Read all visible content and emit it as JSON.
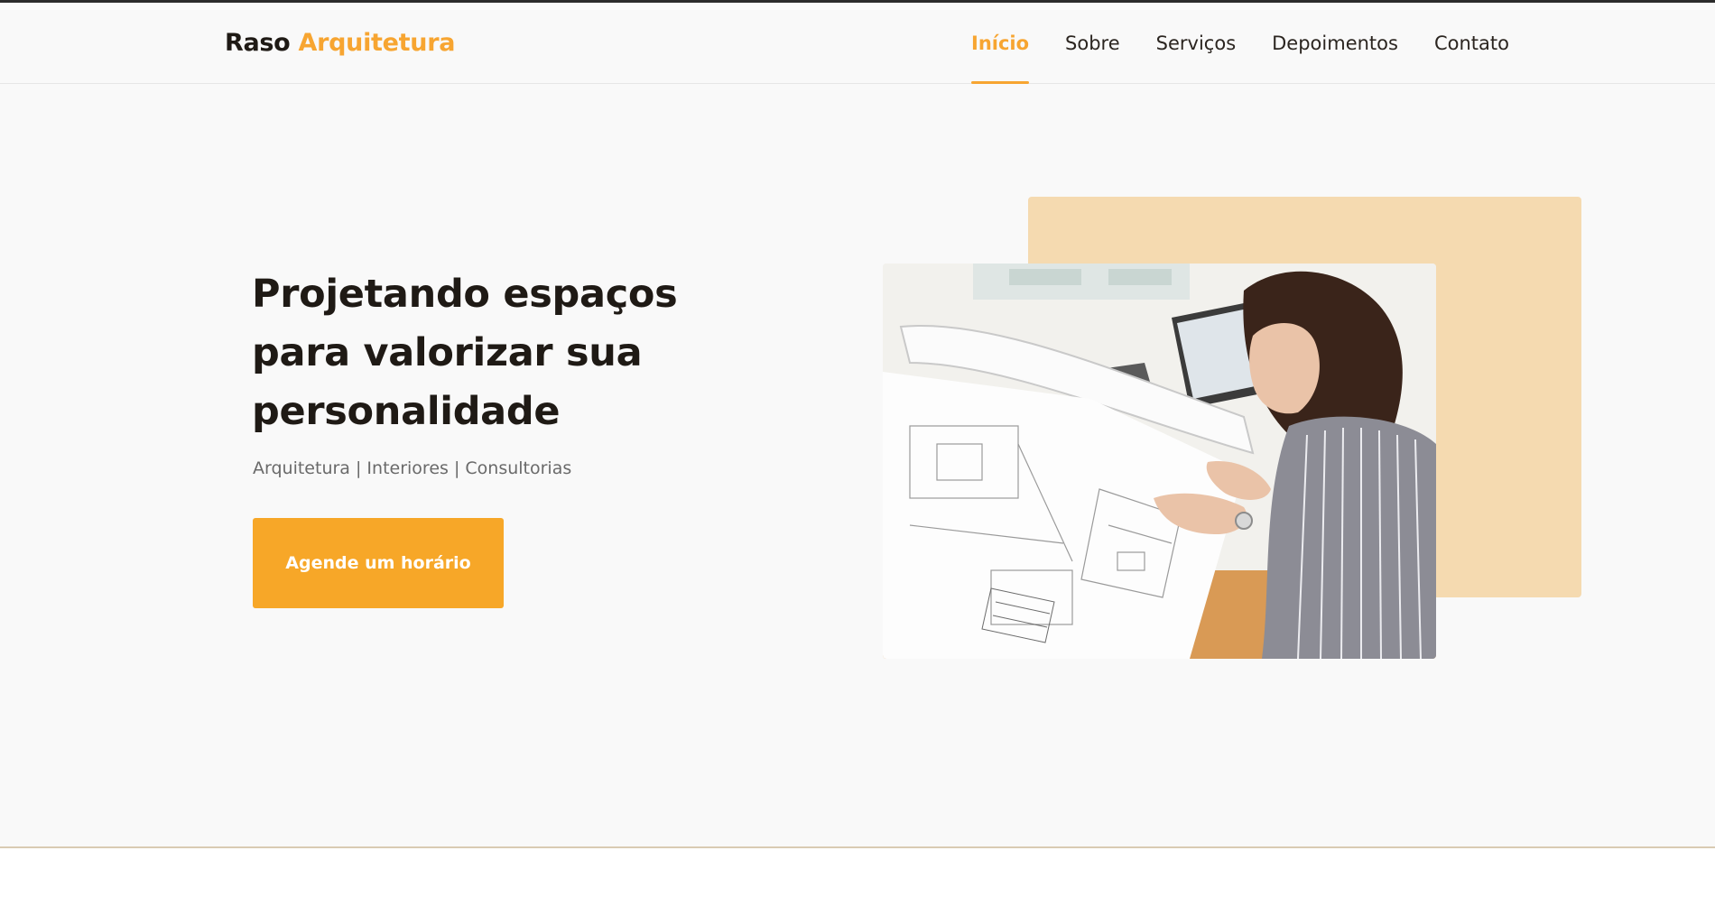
{
  "brand": {
    "name_part1": "Raso",
    "name_part2": "Arquitetura"
  },
  "nav": {
    "items": [
      {
        "label": "Início",
        "active": true
      },
      {
        "label": "Sobre",
        "active": false
      },
      {
        "label": "Serviços",
        "active": false
      },
      {
        "label": "Depoimentos",
        "active": false
      },
      {
        "label": "Contato",
        "active": false
      }
    ]
  },
  "hero": {
    "headline": "Projetando espaços para valorizar sua personalidade",
    "subtitle": "Arquitetura | Interiores | Consultorias",
    "cta_label": "Agende um horário"
  },
  "colors": {
    "accent": "#f7a531",
    "button": "#f7a728",
    "deco_block": "#f5dab0",
    "text_dark": "#1f1a15",
    "text_muted": "#6a6a6a",
    "background": "#f9f9f9"
  }
}
